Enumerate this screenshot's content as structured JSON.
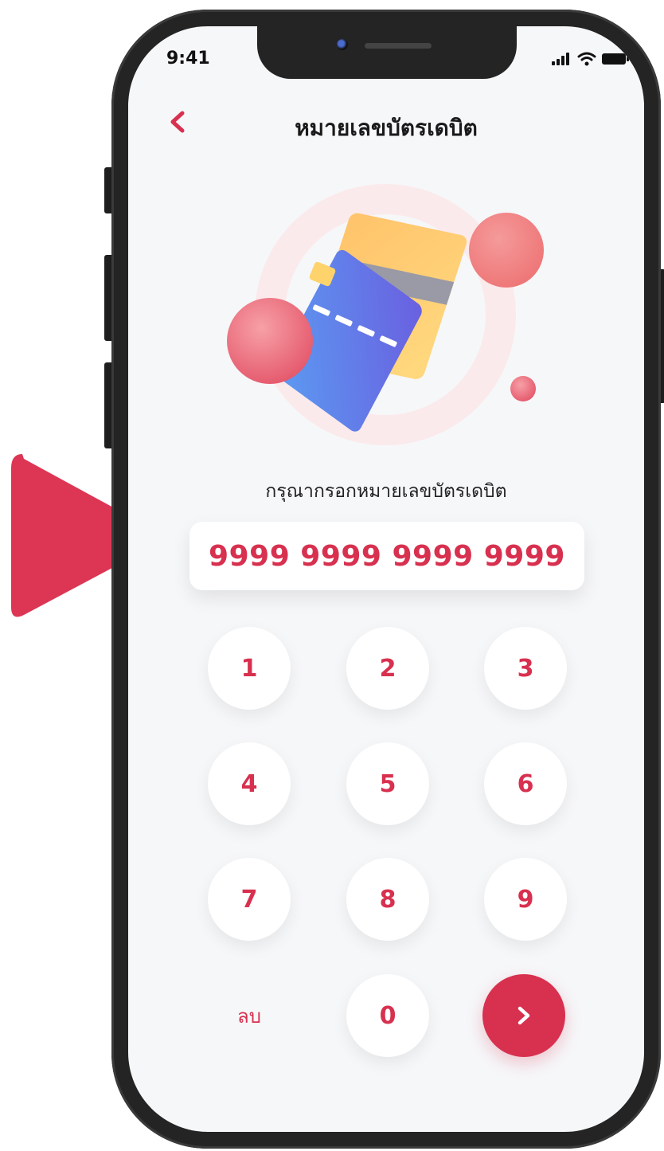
{
  "colors": {
    "accent": "#d8304f",
    "background": "#f6f7f9",
    "phone_frame": "#242424"
  },
  "status_bar": {
    "time": "9:41",
    "icons": [
      "signal-icon",
      "wifi-icon",
      "battery-icon"
    ]
  },
  "header": {
    "back_icon": "chevron-left-icon",
    "title": "หมายเลขบัตรเดบิต"
  },
  "form": {
    "prompt": "กรุณากรอกหมายเลขบัตรเดบิต",
    "card_number": "9999 9999 9999 9999"
  },
  "keypad": {
    "keys": [
      "1",
      "2",
      "3",
      "4",
      "5",
      "6",
      "7",
      "8",
      "9",
      "0"
    ],
    "delete_label": "ลบ",
    "next_icon": "chevron-right-icon"
  }
}
